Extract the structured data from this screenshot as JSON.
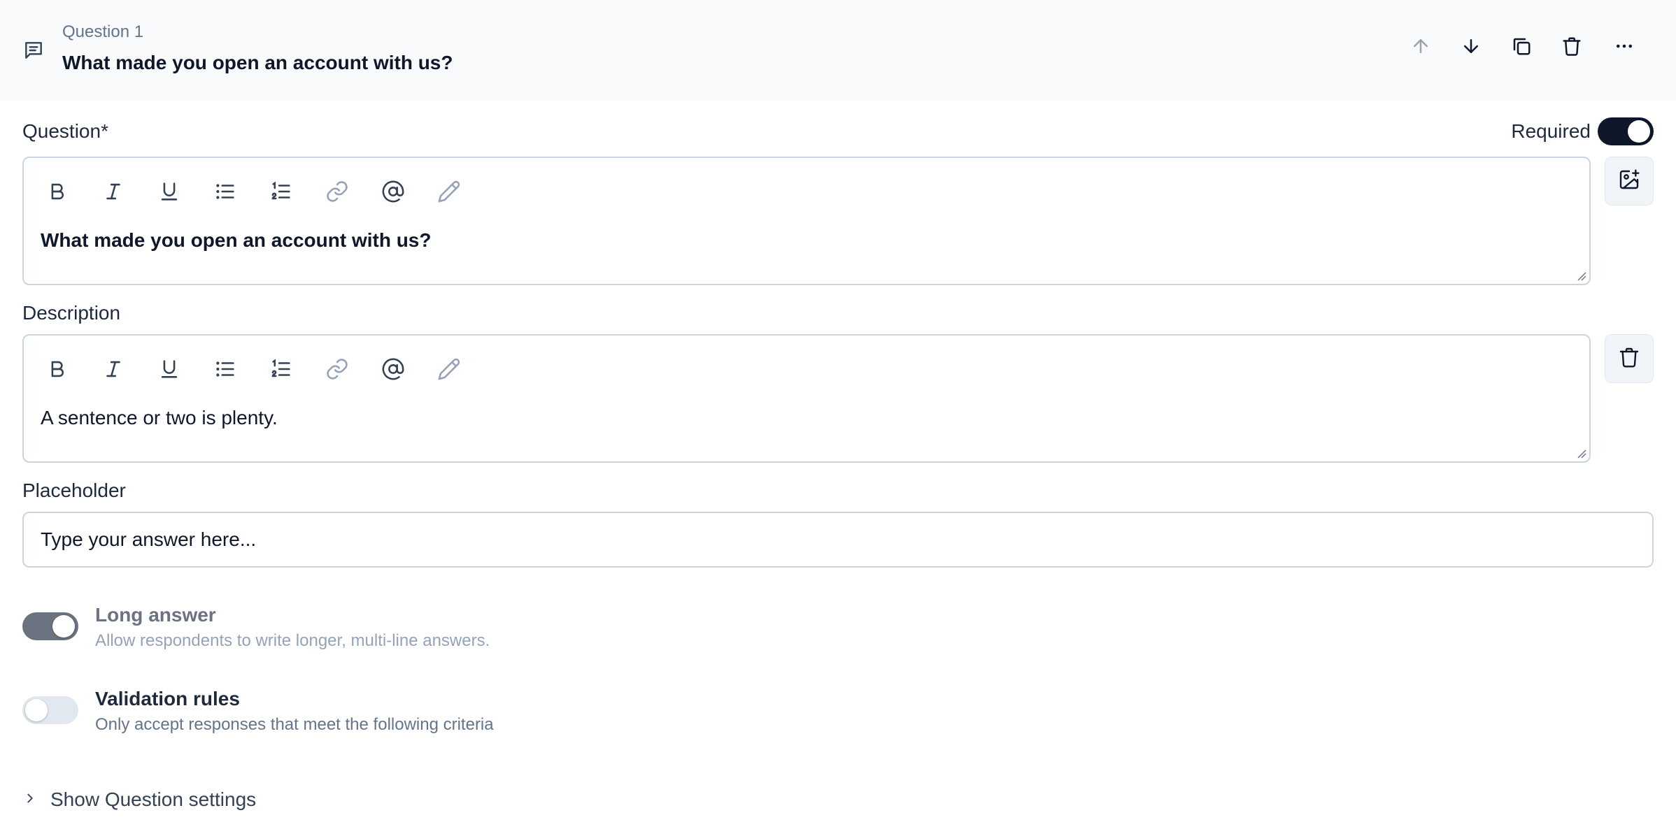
{
  "header": {
    "eyebrow": "Question 1",
    "title": "What made you open an account with us?",
    "icon": "message-square-text-icon",
    "actions": [
      "arrow-up-icon",
      "arrow-down-icon",
      "copy-icon",
      "trash-icon",
      "more-horizontal-icon"
    ]
  },
  "question": {
    "label": "Question*",
    "required_label": "Required",
    "required": true,
    "text": "What made you open an account with us?",
    "side_action_icon": "image-plus-icon"
  },
  "description": {
    "label": "Description",
    "text": "A sentence or two is plenty.",
    "side_action_icon": "trash-icon"
  },
  "toolbar_icons": [
    "bold-icon",
    "italic-icon",
    "underline-icon",
    "bullet-list-icon",
    "numbered-list-icon",
    "link-icon",
    "mention-icon",
    "pencil-icon"
  ],
  "placeholder": {
    "label": "Placeholder",
    "value": "Type your answer here..."
  },
  "options": [
    {
      "title": "Long answer",
      "description": "Allow respondents to write longer, multi-line answers.",
      "enabled": true,
      "disabled": true
    },
    {
      "title": "Validation rules",
      "description": "Only accept responses that meet the following criteria",
      "enabled": false,
      "disabled": false
    }
  ],
  "settings": {
    "label": "Show Question settings"
  },
  "colors": {
    "toggle_on": "#0f172a",
    "toggle_disabled_on": "#6b7280",
    "toggle_off": "#e2e8f0",
    "header_bg": "#f8fafc",
    "border": "#cbd5e1"
  }
}
